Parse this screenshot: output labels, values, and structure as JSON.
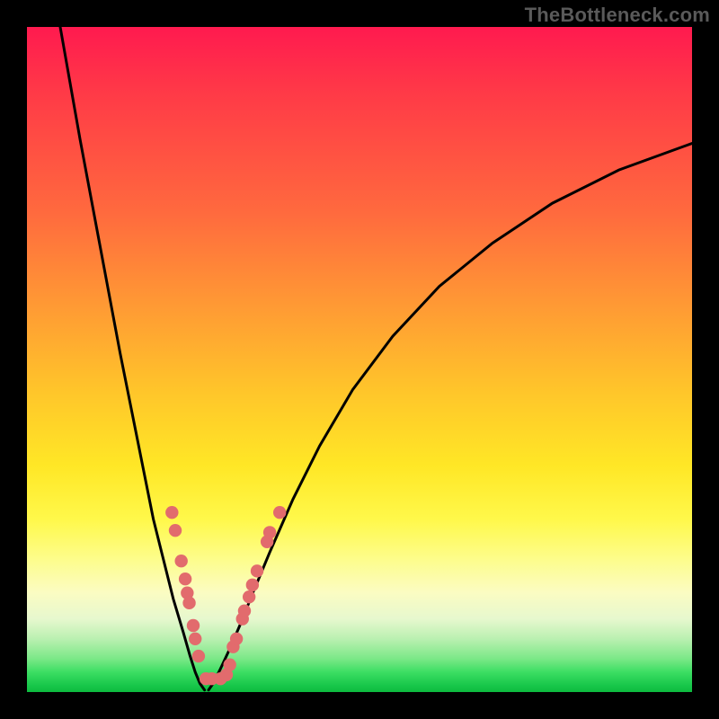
{
  "watermark": "TheBottleneck.com",
  "colors": {
    "frame": "#000000",
    "gradient_stops": [
      "#ff1a4f",
      "#ff3a47",
      "#ff6a3e",
      "#ff9a34",
      "#ffc62a",
      "#ffe726",
      "#fff84a",
      "#fdfd8b",
      "#fbfcc2",
      "#e7f8ce",
      "#baf0b1",
      "#7be887",
      "#3cde63",
      "#18c74a",
      "#0dbb3f"
    ],
    "curve": "#000000",
    "marker": "#e26b6d"
  },
  "chart_data": {
    "type": "line",
    "title": "",
    "xlabel": "",
    "ylabel": "",
    "xlim": [
      0,
      100
    ],
    "ylim": [
      0,
      100
    ],
    "grid": false,
    "legend_position": "none",
    "series": [
      {
        "name": "left-branch",
        "x": [
          5,
          8,
          11,
          14,
          17,
          19,
          20.5,
          22,
          23.5,
          24.5,
          25.3,
          26,
          26.7
        ],
        "y": [
          100,
          83,
          67,
          51,
          36,
          26,
          20,
          14,
          9,
          5.5,
          3,
          1.3,
          0.3
        ]
      },
      {
        "name": "right-branch",
        "x": [
          27.3,
          28,
          29,
          30.5,
          32,
          34,
          36.5,
          40,
          44,
          49,
          55,
          62,
          70,
          79,
          89,
          100
        ],
        "y": [
          0.3,
          1.3,
          3.3,
          6.5,
          10,
          15,
          21,
          29,
          37,
          45.5,
          53.5,
          61,
          67.5,
          73.5,
          78.5,
          82.5
        ]
      }
    ],
    "annotations": {
      "markers_note": "salmon dots along lower V region",
      "marker_points": [
        {
          "x": 21.8,
          "y": 27.0
        },
        {
          "x": 22.3,
          "y": 24.3
        },
        {
          "x": 23.2,
          "y": 19.7
        },
        {
          "x": 23.8,
          "y": 17.0
        },
        {
          "x": 24.1,
          "y": 14.9
        },
        {
          "x": 24.4,
          "y": 13.4
        },
        {
          "x": 25.0,
          "y": 10.0
        },
        {
          "x": 25.3,
          "y": 8.0
        },
        {
          "x": 25.8,
          "y": 5.4
        },
        {
          "x": 26.9,
          "y": 2.0
        },
        {
          "x": 27.8,
          "y": 2.0
        },
        {
          "x": 29.1,
          "y": 2.0
        },
        {
          "x": 30.0,
          "y": 2.6
        },
        {
          "x": 30.5,
          "y": 4.1
        },
        {
          "x": 31.0,
          "y": 6.8
        },
        {
          "x": 31.5,
          "y": 8.0
        },
        {
          "x": 32.4,
          "y": 11.0
        },
        {
          "x": 32.7,
          "y": 12.2
        },
        {
          "x": 33.4,
          "y": 14.3
        },
        {
          "x": 33.9,
          "y": 16.1
        },
        {
          "x": 34.6,
          "y": 18.2
        },
        {
          "x": 36.1,
          "y": 22.6
        },
        {
          "x": 36.5,
          "y": 24.0
        },
        {
          "x": 38.0,
          "y": 27.0
        }
      ]
    }
  }
}
